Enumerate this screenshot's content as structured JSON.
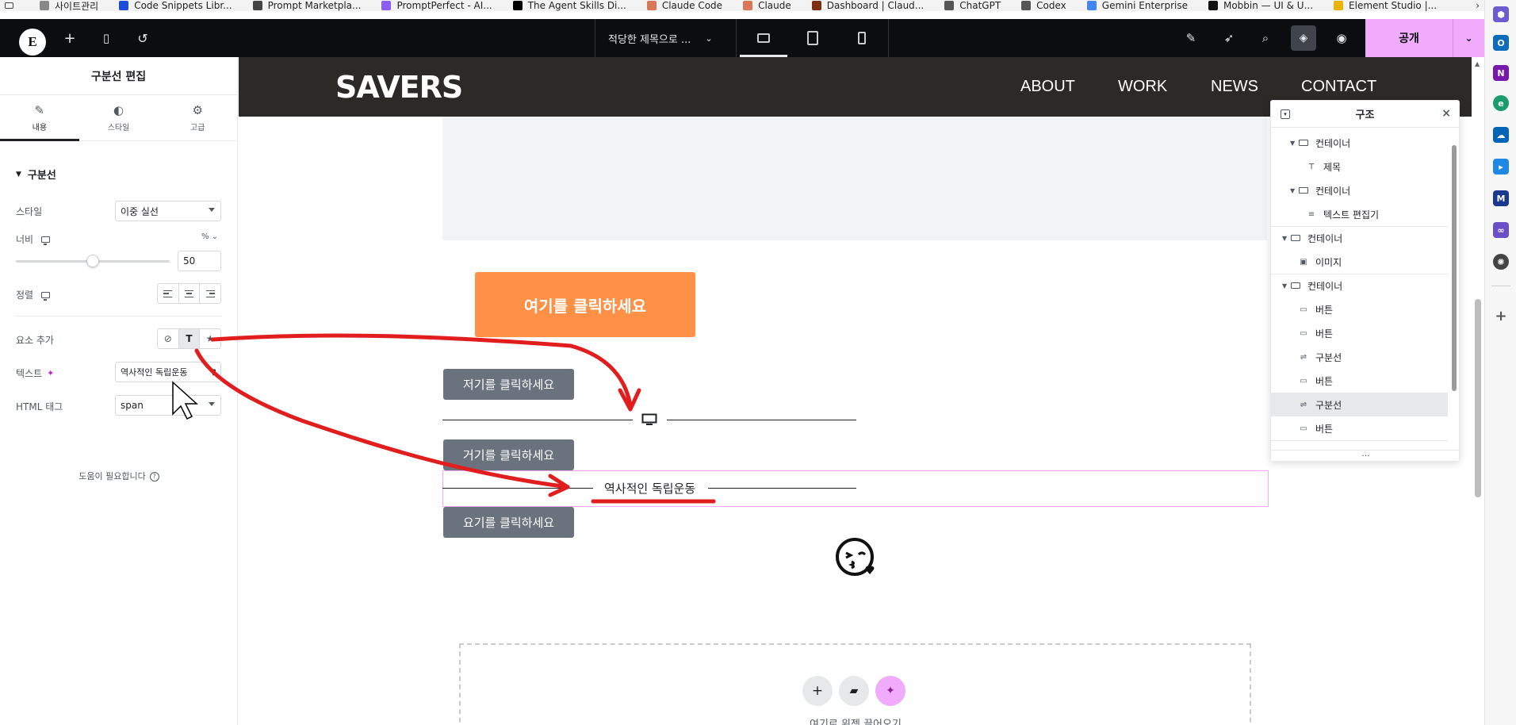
{
  "bookmarks": [
    {
      "label": "사이트관리",
      "color": "#888888",
      "icon": "folder-icon"
    },
    {
      "label": "Code Snippets Libr...",
      "color": "#1d4ed8",
      "icon": "code-snippets-icon"
    },
    {
      "label": "Prompt Marketpla...",
      "color": "#444444",
      "icon": "prompt-marketplace-icon"
    },
    {
      "label": "PromptPerfect - AI...",
      "color": "#8b5cf6",
      "icon": "promptperfect-icon"
    },
    {
      "label": "The Agent Skills Di...",
      "color": "#000000",
      "icon": "agent-skills-icon"
    },
    {
      "label": "Claude Code",
      "color": "#d97757",
      "icon": "claude-icon"
    },
    {
      "label": "Claude",
      "color": "#d97757",
      "icon": "claude-icon"
    },
    {
      "label": "Dashboard | Claud...",
      "color": "#7c2d12",
      "icon": "dashboard-icon"
    },
    {
      "label": "ChatGPT",
      "color": "#555555",
      "icon": "chatgpt-icon"
    },
    {
      "label": "Codex",
      "color": "#555555",
      "icon": "codex-icon"
    },
    {
      "label": "Gemini Enterprise",
      "color": "#4285f4",
      "icon": "gemini-icon"
    },
    {
      "label": "Mobbin — UI & U...",
      "color": "#111111",
      "icon": "mobbin-icon"
    },
    {
      "label": "Element Studio |...",
      "color": "#eab308",
      "icon": "element-studio-icon"
    }
  ],
  "topbar": {
    "doc_title": "적당한 제목으로 ...",
    "publish_label": "공개"
  },
  "panel": {
    "title": "구분선 편집",
    "tabs": [
      {
        "label": "내용",
        "icon": "pencil-icon"
      },
      {
        "label": "스타일",
        "icon": "half-circle-icon"
      },
      {
        "label": "고급",
        "icon": "gear-icon"
      }
    ],
    "section_title": "구분선",
    "style_label": "스타일",
    "style_value": "이중 실선",
    "width_label": "너비",
    "width_unit": "%",
    "width_value": "50",
    "width_slider_fraction": 0.5,
    "align_label": "정렬",
    "add_element_label": "요소 추가",
    "add_element_options": [
      "none",
      "T",
      "★"
    ],
    "text_label": "텍스트",
    "text_value": "역사적인 독립운동",
    "html_tag_label": "HTML 태그",
    "html_tag_value": "span",
    "help_text": "도움이 필요합니다"
  },
  "canvas": {
    "logo": "SAVERS",
    "nav": [
      "ABOUT",
      "WORK",
      "NEWS",
      "CONTACT"
    ],
    "orange_button": "여기를 클릭하세요",
    "gray_buttons": [
      "저기를 클릭하세요",
      "거기를 클릭하세요",
      "요기를 클릭하세요"
    ],
    "divider_text": "역사적인 독립운동",
    "drop_hint": "여기로 위젯 끌어오기"
  },
  "structure": {
    "title": "구조",
    "items": [
      {
        "label": "컨테이너",
        "type": "container",
        "level": 1,
        "twisty": true
      },
      {
        "label": "제목",
        "type": "heading",
        "level": 2,
        "twisty": false
      },
      {
        "label": "컨테이너",
        "type": "container",
        "level": 1,
        "twisty": true
      },
      {
        "label": "텍스트 편집기",
        "type": "text-editor",
        "level": 2,
        "twisty": false
      },
      {
        "label": "컨테이너",
        "type": "container",
        "level": 0,
        "twisty": true
      },
      {
        "label": "이미지",
        "type": "image",
        "level": 1,
        "twisty": false
      },
      {
        "label": "컨테이너",
        "type": "container",
        "level": 0,
        "twisty": true
      },
      {
        "label": "버튼",
        "type": "button",
        "level": 1,
        "twisty": false
      },
      {
        "label": "버튼",
        "type": "button",
        "level": 1,
        "twisty": false
      },
      {
        "label": "구분선",
        "type": "divider",
        "level": 1,
        "twisty": false
      },
      {
        "label": "버튼",
        "type": "button",
        "level": 1,
        "twisty": false
      },
      {
        "label": "구분선",
        "type": "divider",
        "level": 1,
        "twisty": false,
        "selected": true
      },
      {
        "label": "버튼",
        "type": "button",
        "level": 1,
        "twisty": false
      }
    ]
  },
  "colors": {
    "accent_pink": "#f0abfc",
    "orange": "#ff9146",
    "button_gray": "#69727d",
    "annotation_red": "#e11d1d"
  }
}
